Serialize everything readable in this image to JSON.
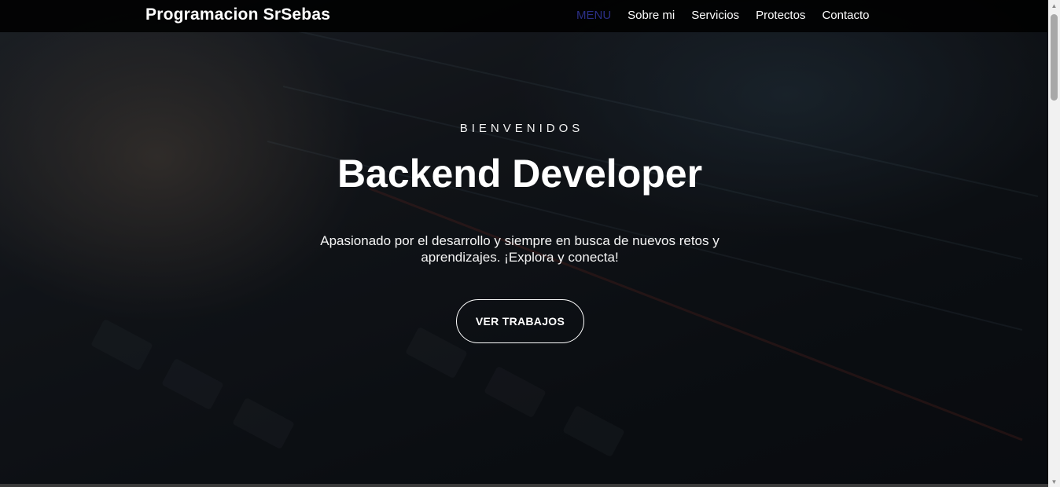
{
  "navbar": {
    "brand": "Programacion SrSebas",
    "links": [
      {
        "label": "MENU",
        "active": true
      },
      {
        "label": "Sobre mi",
        "active": false
      },
      {
        "label": "Servicios",
        "active": false
      },
      {
        "label": "Protectos",
        "active": false
      },
      {
        "label": "Contacto",
        "active": false
      }
    ]
  },
  "hero": {
    "eyebrow": "BIENVENIDOS",
    "headline": "Backend Developer",
    "tagline": "Apasionado por el desarrollo y siempre en busca de nuevos retos y aprendizajes. ¡Explora y conecta!",
    "cta_label": "VER TRABAJOS"
  },
  "colors": {
    "nav_active": "#2b2f86",
    "text": "#ffffff",
    "navbar_bg": "#000000"
  },
  "icons": {
    "scroll_up": "triangle-up-icon",
    "scroll_down": "triangle-down-icon"
  }
}
